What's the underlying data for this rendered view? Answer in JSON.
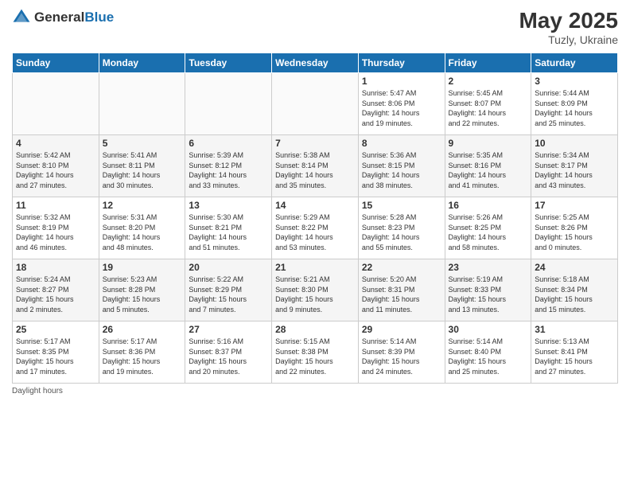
{
  "header": {
    "logo_general": "General",
    "logo_blue": "Blue",
    "month_year": "May 2025",
    "location": "Tuzly, Ukraine"
  },
  "days_of_week": [
    "Sunday",
    "Monday",
    "Tuesday",
    "Wednesday",
    "Thursday",
    "Friday",
    "Saturday"
  ],
  "footer_text": "Daylight hours",
  "weeks": [
    [
      {
        "day": "",
        "info": ""
      },
      {
        "day": "",
        "info": ""
      },
      {
        "day": "",
        "info": ""
      },
      {
        "day": "",
        "info": ""
      },
      {
        "day": "1",
        "info": "Sunrise: 5:47 AM\nSunset: 8:06 PM\nDaylight: 14 hours\nand 19 minutes."
      },
      {
        "day": "2",
        "info": "Sunrise: 5:45 AM\nSunset: 8:07 PM\nDaylight: 14 hours\nand 22 minutes."
      },
      {
        "day": "3",
        "info": "Sunrise: 5:44 AM\nSunset: 8:09 PM\nDaylight: 14 hours\nand 25 minutes."
      }
    ],
    [
      {
        "day": "4",
        "info": "Sunrise: 5:42 AM\nSunset: 8:10 PM\nDaylight: 14 hours\nand 27 minutes."
      },
      {
        "day": "5",
        "info": "Sunrise: 5:41 AM\nSunset: 8:11 PM\nDaylight: 14 hours\nand 30 minutes."
      },
      {
        "day": "6",
        "info": "Sunrise: 5:39 AM\nSunset: 8:12 PM\nDaylight: 14 hours\nand 33 minutes."
      },
      {
        "day": "7",
        "info": "Sunrise: 5:38 AM\nSunset: 8:14 PM\nDaylight: 14 hours\nand 35 minutes."
      },
      {
        "day": "8",
        "info": "Sunrise: 5:36 AM\nSunset: 8:15 PM\nDaylight: 14 hours\nand 38 minutes."
      },
      {
        "day": "9",
        "info": "Sunrise: 5:35 AM\nSunset: 8:16 PM\nDaylight: 14 hours\nand 41 minutes."
      },
      {
        "day": "10",
        "info": "Sunrise: 5:34 AM\nSunset: 8:17 PM\nDaylight: 14 hours\nand 43 minutes."
      }
    ],
    [
      {
        "day": "11",
        "info": "Sunrise: 5:32 AM\nSunset: 8:19 PM\nDaylight: 14 hours\nand 46 minutes."
      },
      {
        "day": "12",
        "info": "Sunrise: 5:31 AM\nSunset: 8:20 PM\nDaylight: 14 hours\nand 48 minutes."
      },
      {
        "day": "13",
        "info": "Sunrise: 5:30 AM\nSunset: 8:21 PM\nDaylight: 14 hours\nand 51 minutes."
      },
      {
        "day": "14",
        "info": "Sunrise: 5:29 AM\nSunset: 8:22 PM\nDaylight: 14 hours\nand 53 minutes."
      },
      {
        "day": "15",
        "info": "Sunrise: 5:28 AM\nSunset: 8:23 PM\nDaylight: 14 hours\nand 55 minutes."
      },
      {
        "day": "16",
        "info": "Sunrise: 5:26 AM\nSunset: 8:25 PM\nDaylight: 14 hours\nand 58 minutes."
      },
      {
        "day": "17",
        "info": "Sunrise: 5:25 AM\nSunset: 8:26 PM\nDaylight: 15 hours\nand 0 minutes."
      }
    ],
    [
      {
        "day": "18",
        "info": "Sunrise: 5:24 AM\nSunset: 8:27 PM\nDaylight: 15 hours\nand 2 minutes."
      },
      {
        "day": "19",
        "info": "Sunrise: 5:23 AM\nSunset: 8:28 PM\nDaylight: 15 hours\nand 5 minutes."
      },
      {
        "day": "20",
        "info": "Sunrise: 5:22 AM\nSunset: 8:29 PM\nDaylight: 15 hours\nand 7 minutes."
      },
      {
        "day": "21",
        "info": "Sunrise: 5:21 AM\nSunset: 8:30 PM\nDaylight: 15 hours\nand 9 minutes."
      },
      {
        "day": "22",
        "info": "Sunrise: 5:20 AM\nSunset: 8:31 PM\nDaylight: 15 hours\nand 11 minutes."
      },
      {
        "day": "23",
        "info": "Sunrise: 5:19 AM\nSunset: 8:33 PM\nDaylight: 15 hours\nand 13 minutes."
      },
      {
        "day": "24",
        "info": "Sunrise: 5:18 AM\nSunset: 8:34 PM\nDaylight: 15 hours\nand 15 minutes."
      }
    ],
    [
      {
        "day": "25",
        "info": "Sunrise: 5:17 AM\nSunset: 8:35 PM\nDaylight: 15 hours\nand 17 minutes."
      },
      {
        "day": "26",
        "info": "Sunrise: 5:17 AM\nSunset: 8:36 PM\nDaylight: 15 hours\nand 19 minutes."
      },
      {
        "day": "27",
        "info": "Sunrise: 5:16 AM\nSunset: 8:37 PM\nDaylight: 15 hours\nand 20 minutes."
      },
      {
        "day": "28",
        "info": "Sunrise: 5:15 AM\nSunset: 8:38 PM\nDaylight: 15 hours\nand 22 minutes."
      },
      {
        "day": "29",
        "info": "Sunrise: 5:14 AM\nSunset: 8:39 PM\nDaylight: 15 hours\nand 24 minutes."
      },
      {
        "day": "30",
        "info": "Sunrise: 5:14 AM\nSunset: 8:40 PM\nDaylight: 15 hours\nand 25 minutes."
      },
      {
        "day": "31",
        "info": "Sunrise: 5:13 AM\nSunset: 8:41 PM\nDaylight: 15 hours\nand 27 minutes."
      }
    ]
  ]
}
